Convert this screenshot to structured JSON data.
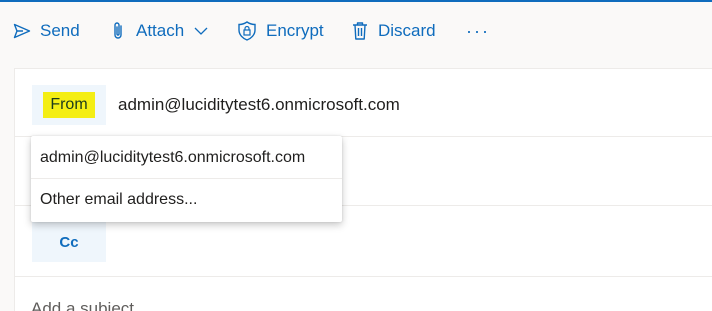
{
  "toolbar": {
    "send_label": "Send",
    "attach_label": "Attach",
    "encrypt_label": "Encrypt",
    "discard_label": "Discard",
    "more_label": "···"
  },
  "compose": {
    "from_label": "From",
    "from_value": "admin@luciditytest6.onmicrosoft.com",
    "cc_label": "Cc",
    "subject_placeholder": "Add a subject"
  },
  "from_dropdown": {
    "options": [
      "admin@luciditytest6.onmicrosoft.com",
      "Other email address..."
    ]
  },
  "colors": {
    "accent": "#0f6cbd",
    "highlight": "#f4ee14",
    "chip_bg": "#eff6fc"
  }
}
